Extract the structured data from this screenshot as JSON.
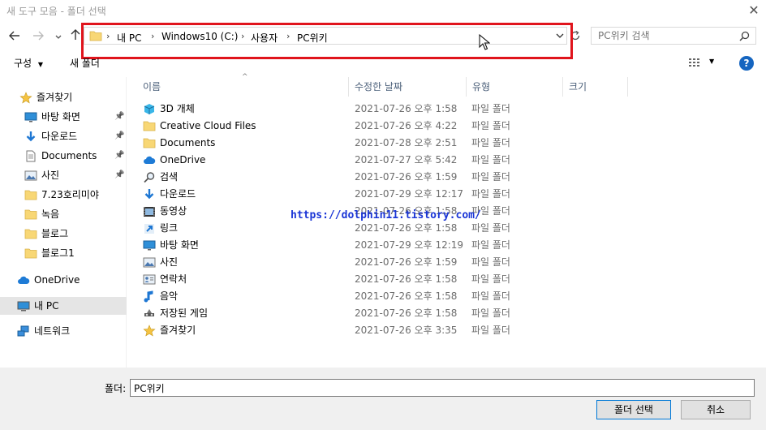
{
  "window": {
    "title": "새 도구 모음 - 폴더 선택"
  },
  "nav": {
    "back_icon": "back-arrow-icon",
    "forward_icon": "forward-arrow-icon",
    "recent_icon": "chevron-down-icon",
    "up_icon": "up-arrow-icon"
  },
  "address": {
    "crumbs": [
      "내 PC",
      "Windows10 (C:)",
      "사용자",
      "PC위키"
    ]
  },
  "search": {
    "placeholder": "PC위키 검색"
  },
  "toolbar": {
    "organize_label": "구성",
    "new_folder_label": "새 폴더"
  },
  "sidebar": {
    "items": [
      {
        "label": "즐겨찾기",
        "icon": "star-icon"
      },
      {
        "label": "바탕 화면",
        "icon": "desktop-icon",
        "pinned": true
      },
      {
        "label": "다운로드",
        "icon": "download-icon",
        "pinned": true
      },
      {
        "label": "Documents",
        "icon": "document-icon",
        "pinned": true
      },
      {
        "label": "사진",
        "icon": "picture-icon",
        "pinned": true
      },
      {
        "label": "7.23호리미야",
        "icon": "folder-icon"
      },
      {
        "label": "녹음",
        "icon": "folder-icon"
      },
      {
        "label": "블로그",
        "icon": "folder-icon"
      },
      {
        "label": "블로그1",
        "icon": "folder-icon"
      },
      {
        "label": "OneDrive",
        "icon": "cloud-icon"
      },
      {
        "label": "내 PC",
        "icon": "pc-icon",
        "selected": true
      },
      {
        "label": "네트워크",
        "icon": "network-icon"
      }
    ]
  },
  "columns": {
    "name": "이름",
    "modified": "수정한 날짜",
    "type": "유형",
    "size": "크기"
  },
  "files": [
    {
      "name": "3D 개체",
      "date": "2021-07-26 오후 1:58",
      "type": "파일 폴더",
      "icon": "3d-objects-icon"
    },
    {
      "name": "Creative Cloud Files",
      "date": "2021-07-26 오후 4:22",
      "type": "파일 폴더",
      "icon": "folder-icon"
    },
    {
      "name": "Documents",
      "date": "2021-07-28 오후 2:51",
      "type": "파일 폴더",
      "icon": "folder-icon"
    },
    {
      "name": "OneDrive",
      "date": "2021-07-27 오후 5:42",
      "type": "파일 폴더",
      "icon": "cloud-icon"
    },
    {
      "name": "검색",
      "date": "2021-07-26 오후 1:59",
      "type": "파일 폴더",
      "icon": "search-icon"
    },
    {
      "name": "다운로드",
      "date": "2021-07-29 오후 12:17",
      "type": "파일 폴더",
      "icon": "download-icon"
    },
    {
      "name": "동영상",
      "date": "2021-07-26 오후 1:58",
      "type": "파일 폴더",
      "icon": "video-icon"
    },
    {
      "name": "링크",
      "date": "2021-07-26 오후 1:58",
      "type": "파일 폴더",
      "icon": "link-icon"
    },
    {
      "name": "바탕 화면",
      "date": "2021-07-29 오후 12:19",
      "type": "파일 폴더",
      "icon": "desktop-icon"
    },
    {
      "name": "사진",
      "date": "2021-07-26 오후 1:59",
      "type": "파일 폴더",
      "icon": "picture-icon"
    },
    {
      "name": "연락처",
      "date": "2021-07-26 오후 1:58",
      "type": "파일 폴더",
      "icon": "contacts-icon"
    },
    {
      "name": "음악",
      "date": "2021-07-26 오후 1:58",
      "type": "파일 폴더",
      "icon": "music-icon"
    },
    {
      "name": "저장된 게임",
      "date": "2021-07-26 오후 1:58",
      "type": "파일 폴더",
      "icon": "games-icon"
    },
    {
      "name": "즐겨찾기",
      "date": "2021-07-26 오후 3:35",
      "type": "파일 폴더",
      "icon": "star-icon"
    }
  ],
  "watermark": "https://dolphin11.tistory.com/",
  "footer": {
    "folder_label": "폴더:",
    "folder_value": "PC위키",
    "select_button": "폴더 선택",
    "cancel_button": "취소"
  },
  "colors": {
    "highlight": "#e0141c",
    "folder": "#f8d775",
    "accent": "#0078d7",
    "watermark": "#1a35d6"
  }
}
